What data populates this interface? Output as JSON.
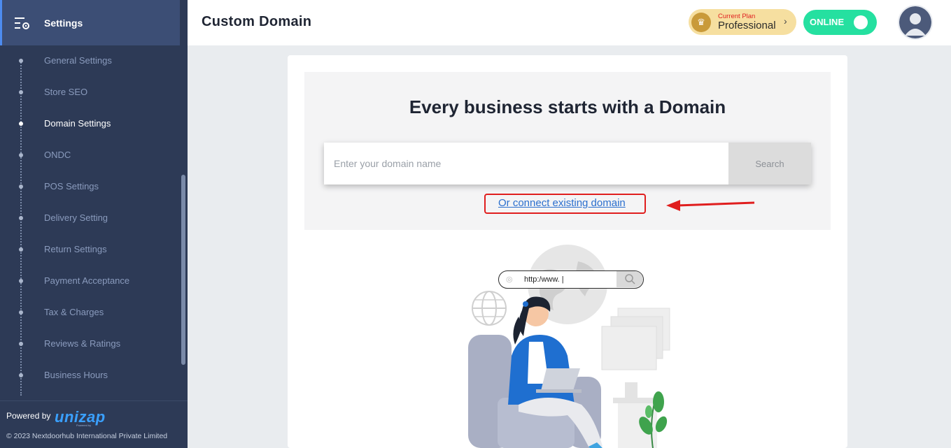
{
  "sidebar": {
    "title": "Settings",
    "items": [
      {
        "label": "General Settings",
        "active": false
      },
      {
        "label": "Store SEO",
        "active": false
      },
      {
        "label": "Domain Settings",
        "active": true
      },
      {
        "label": "ONDC",
        "active": false
      },
      {
        "label": "POS Settings",
        "active": false
      },
      {
        "label": "Delivery Setting",
        "active": false
      },
      {
        "label": "Return Settings",
        "active": false
      },
      {
        "label": "Payment Acceptance",
        "active": false
      },
      {
        "label": "Tax & Charges",
        "active": false
      },
      {
        "label": "Reviews & Ratings",
        "active": false
      },
      {
        "label": "Business Hours",
        "active": false
      }
    ],
    "footer": {
      "powered_by": "Powered by",
      "brand": "unizap",
      "brand_sub": "Powered by",
      "copyright": "© 2023 Nextdoorhub International Private Limited"
    }
  },
  "header": {
    "title": "Custom Domain",
    "plan_label": "Current Plan",
    "plan_name": "Professional",
    "status": "ONLINE"
  },
  "main": {
    "hero_title": "Every business starts with a Domain",
    "search_placeholder": "Enter your domain name",
    "search_button": "Search",
    "connect_link": "Or connect existing domain",
    "illustration_url": "http:/www. |"
  },
  "colors": {
    "sidebar_bg": "#2d3a56",
    "sidebar_active_bg": "#3c4e75",
    "online": "#25e0a0",
    "plan_bg": "#f6dfa0",
    "highlight": "#e01e1e",
    "link": "#2b6fce"
  }
}
